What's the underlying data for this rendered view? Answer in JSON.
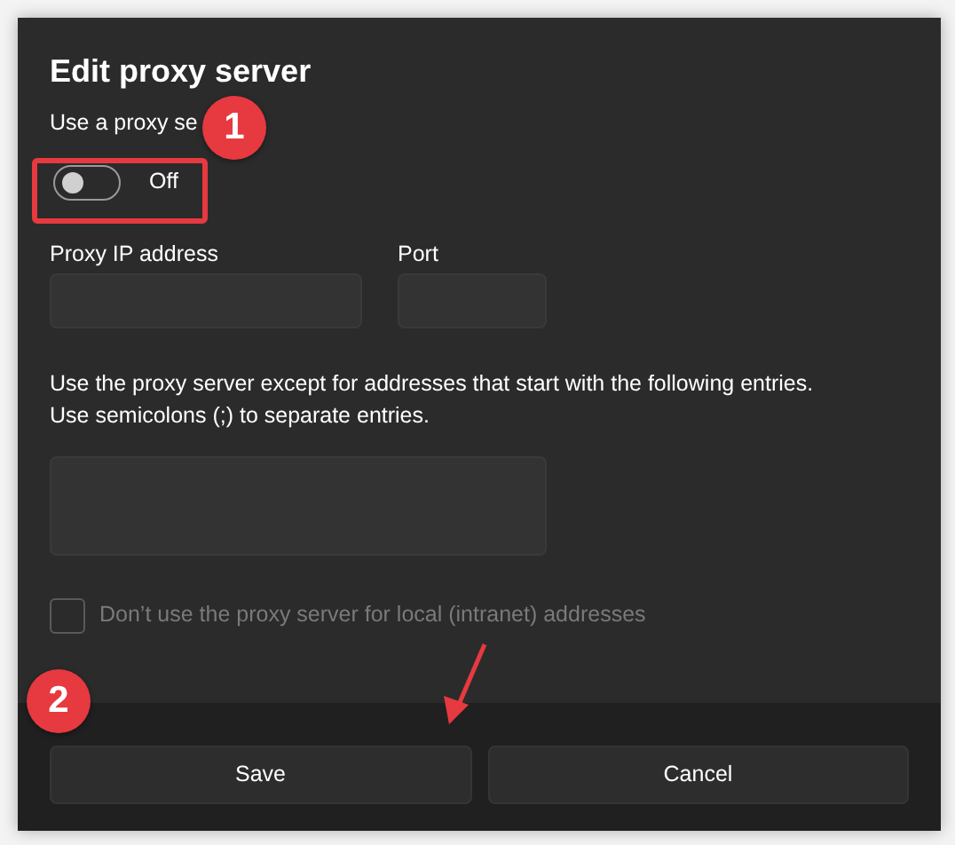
{
  "dialog": {
    "title": "Edit proxy server",
    "toggle_label": "Use a proxy se",
    "toggle": {
      "on": false,
      "state_text": "Off"
    },
    "fields": [
      {
        "label": "Proxy IP address"
      },
      {
        "label": "Port"
      }
    ],
    "exceptions": {
      "lines": [
        "Use the proxy server except for addresses that start with the following entries.",
        "Use semicolons (;) to separate entries."
      ]
    },
    "local_checkbox": {
      "label": "Don’t use the proxy server for local (intranet) addresses",
      "checked": false,
      "disabled": true
    },
    "buttons": [
      "Save",
      "Cancel"
    ]
  },
  "annotations": [
    {
      "kind": "badge",
      "text": "1"
    },
    {
      "kind": "box"
    },
    {
      "kind": "badge",
      "text": "2"
    },
    {
      "kind": "arrow"
    }
  ]
}
